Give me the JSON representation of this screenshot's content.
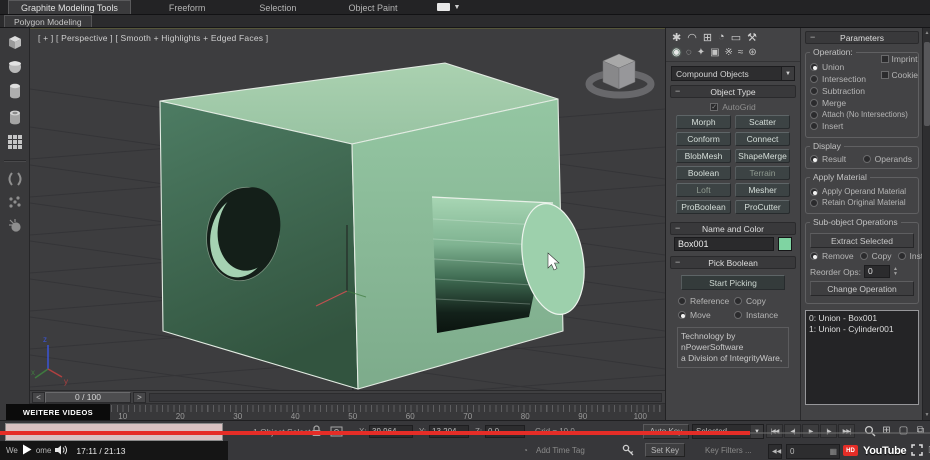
{
  "colors": {
    "accent_green": "#7fd4a2",
    "yt_red": "#e52d27",
    "box_top": "#a3cdaa",
    "box_left": "#47745c",
    "box_right": "#8fc19d"
  },
  "ribbon": {
    "tabs": [
      {
        "label": "Graphite Modeling Tools"
      },
      {
        "label": "Freeform"
      },
      {
        "label": "Selection"
      },
      {
        "label": "Object Paint"
      }
    ],
    "secondary_tab": "Polygon Modeling"
  },
  "viewport": {
    "label": "[ + ] [ Perspective ] [ Smooth + Highlights + Edged Faces ]"
  },
  "timeline": {
    "prev": "<",
    "next": ">",
    "slider_label": "0 / 100",
    "ticks": [
      "10",
      "20",
      "30",
      "40",
      "50",
      "60",
      "70",
      "80",
      "90",
      "100"
    ]
  },
  "status": {
    "prompt": "1 Object Selected",
    "x_label": "X:",
    "x_value": "39.964",
    "y_label": "Y:",
    "y_value": "13.204",
    "z_label": "Z:",
    "z_value": "0.0",
    "grid": "Grid = 10.0",
    "add_time_tag": "Add Time Tag",
    "auto_key": "Auto Key",
    "selection_set": "Selected",
    "set_key": "Set Key",
    "key_filters": "Key Filters ...",
    "frame_value": "0",
    "transport": [
      "|◀◀",
      "◀|",
      "▶",
      "|▶",
      "▶▶|"
    ],
    "nav": [
      "⊞",
      "▢",
      "⧉"
    ]
  },
  "command_panel": {
    "tabs": [
      {
        "glyph": "✱"
      },
      {
        "glyph": "◠"
      },
      {
        "glyph": "⊞"
      },
      {
        "glyph": "◔"
      },
      {
        "glyph": "▭"
      },
      {
        "glyph": "⚒"
      }
    ],
    "categories": [
      {
        "glyph": "◉"
      },
      {
        "glyph": "◌"
      },
      {
        "glyph": "✦"
      },
      {
        "glyph": "▣"
      },
      {
        "glyph": "※"
      },
      {
        "glyph": "≈"
      },
      {
        "glyph": "⊛"
      }
    ],
    "dropdown": "Compound Objects",
    "object_type": {
      "header": "Object Type",
      "autogrid": "AutoGrid",
      "buttons": [
        "Morph",
        "Scatter",
        "Conform",
        "Connect",
        "BlobMesh",
        "ShapeMerge",
        "Boolean",
        "Terrain",
        "Loft",
        "Mesher",
        "ProBoolean",
        "ProCutter"
      ]
    },
    "name_color": {
      "header": "Name and Color",
      "name": "Box001"
    },
    "pick_boolean": {
      "header": "Pick Boolean",
      "start": "Start Picking",
      "options": [
        "Reference",
        "Copy",
        "Move",
        "Instance"
      ]
    },
    "tech_line1": "Technology by nPowerSoftware",
    "tech_line2": "a Division of IntegrityWare,"
  },
  "parameters": {
    "header": "Parameters",
    "operation_label": "Operation:",
    "op_options": [
      "Union",
      "Intersection",
      "Subtraction",
      "Merge",
      "Attach (No Intersections)",
      "Insert"
    ],
    "checkboxes": [
      "Imprint",
      "Cookie"
    ],
    "display_label": "Display",
    "display_options": [
      "Result",
      "Operands"
    ],
    "apply_label": "Apply Material",
    "apply_options": [
      "Apply Operand Material",
      "Retain Original Material"
    ],
    "subobj_label": "Sub-object Operations",
    "extract": "Extract Selected",
    "subobj_radios": [
      "Remove",
      "Copy",
      "Inst"
    ],
    "reorder_label": "Reorder Ops:",
    "reorder_value": "0",
    "change_op": "Change Operation",
    "operands": [
      "0: Union - Box001",
      "1: Union - Cylinder001"
    ]
  },
  "youtube": {
    "more_videos": "WEITERE VIDEOS",
    "fragments": [
      "We",
      "ome"
    ],
    "time": "17:11 / 21:13",
    "hd": "HD",
    "logo": "YouTube"
  }
}
